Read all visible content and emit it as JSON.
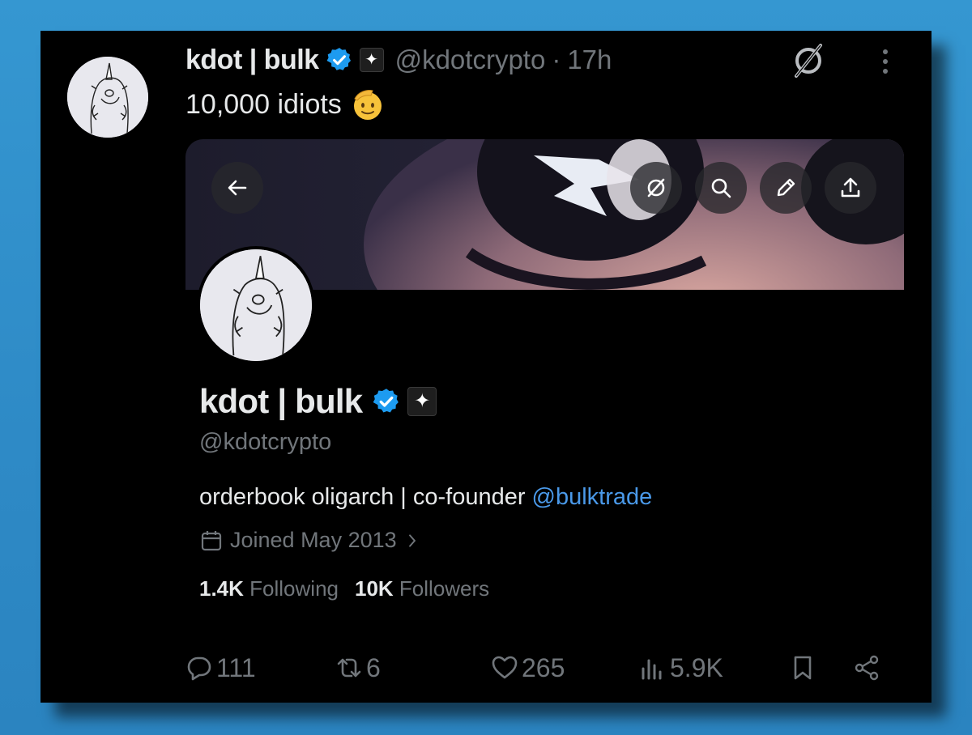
{
  "tweet": {
    "author_name": "kdot | bulk",
    "handle": "@kdotcrypto",
    "separator": "·",
    "time": "17h",
    "text": "10,000 idiots",
    "emoji": "saluting-face",
    "badge_symbol": "✦"
  },
  "profile_screenshot": {
    "name": "kdot | bulk",
    "handle": "@kdotcrypto",
    "bio_prefix": "orderbook oligarch | co-founder ",
    "bio_mention": "@bulktrade",
    "joined": "Joined May 2013",
    "following_count": "1.4K",
    "following_label": "Following",
    "followers_count": "10K",
    "followers_label": "Followers",
    "badge_symbol": "✦",
    "overlay_buttons": [
      "back-arrow-icon",
      "grok-icon",
      "search-icon",
      "edit-pencil-icon",
      "share-upload-icon"
    ]
  },
  "actions": {
    "replies": "111",
    "reposts": "6",
    "likes": "265",
    "views": "5.9K"
  },
  "colors": {
    "background": "#000000",
    "frame": "#2f8fc9",
    "text_primary": "#e7e9ea",
    "text_secondary": "#71767b",
    "verified_blue": "#1d9bf0",
    "mention_blue": "#4a99e9"
  }
}
